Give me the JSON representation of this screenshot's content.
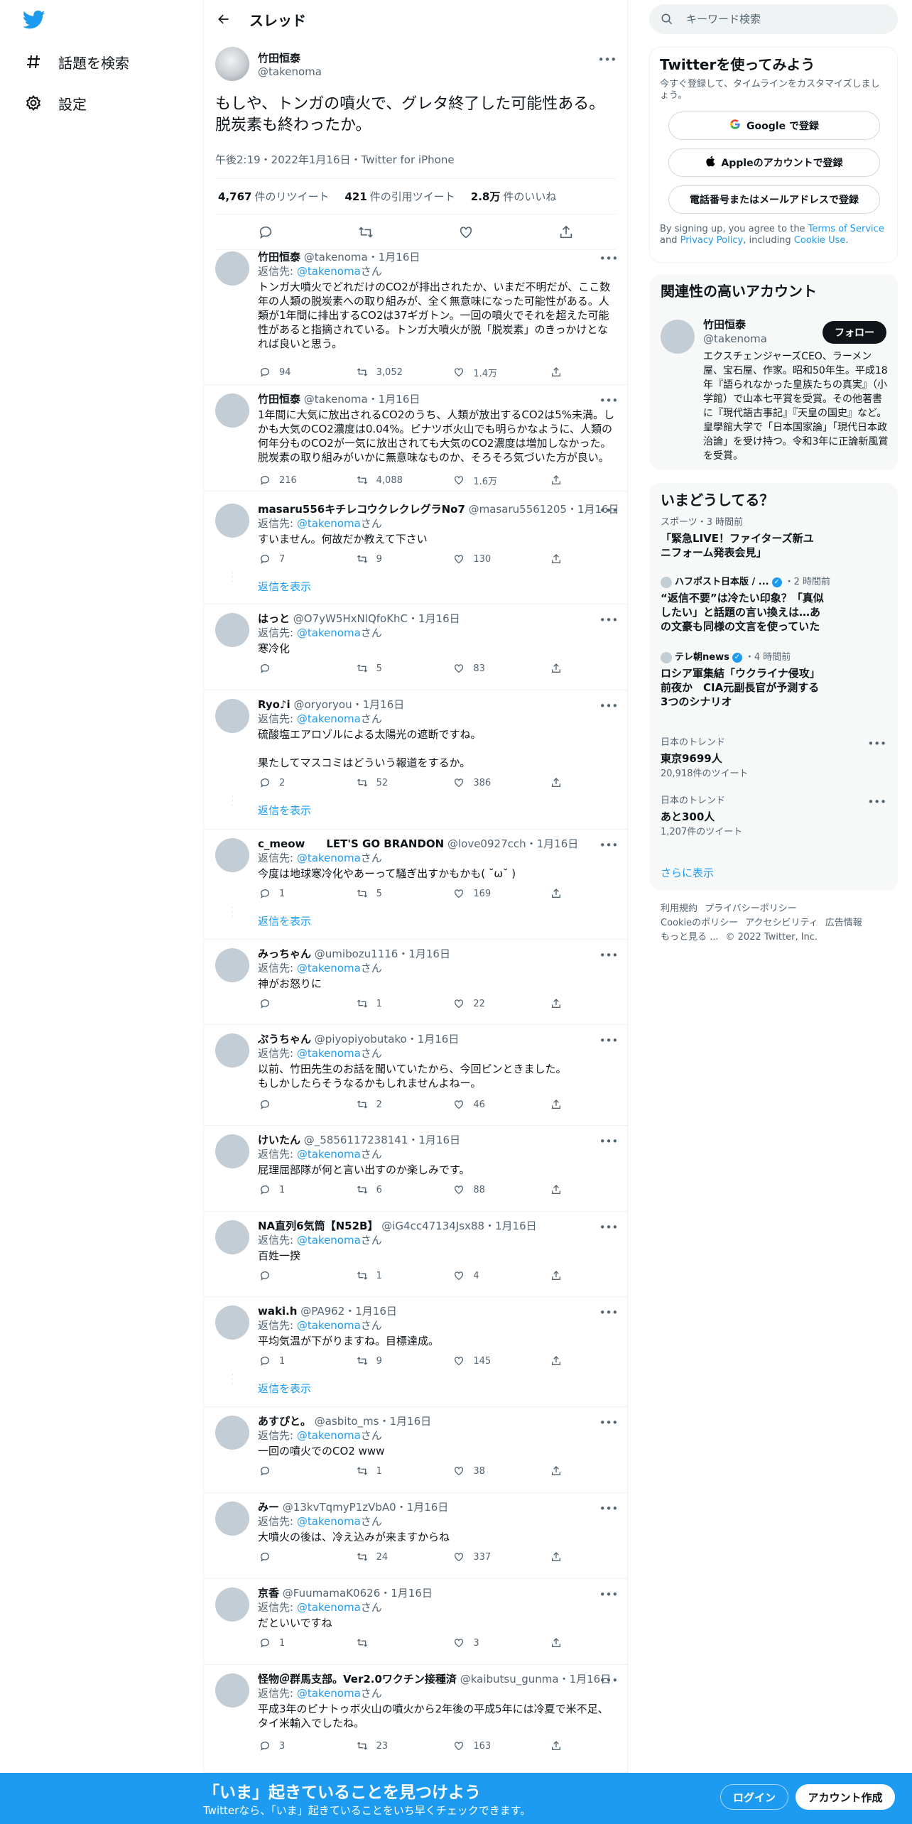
{
  "nav": {
    "explore": "話題を検索",
    "settings": "設定"
  },
  "header": {
    "title": "スレッド"
  },
  "focal": {
    "name": "竹田恒泰",
    "handle": "@takenoma",
    "text": "もしや、トンガの噴火で、グレタ終了した可能性ある。脱炭素も終わったか。",
    "meta": "午後2:19・2022年1月16日・Twitter for iPhone",
    "retweets_num": "4,767",
    "retweets_label": "件のリツイート",
    "quotes_num": "421",
    "quotes_label": "件の引用ツイート",
    "likes_num": "2.8万",
    "likes_label": "件のいいね"
  },
  "replies": [
    {
      "name": "竹田恒泰",
      "handle": "@takenoma",
      "date": "・1月16日",
      "replyto_prefix": "返信先: ",
      "replyto": "@takenoma",
      "replyto_suffix": "さん",
      "text": "トンガ大噴火でどれだけのCO2が排出されたか、いまだ不明だが、ここ数年の人類の脱炭素への取り組みが、全く無意味になった可能性がある。人類が1年間に排出するCO2は37ギガトン。一回の噴火でそれを超えた可能性があると指摘されている。トンガ大噴火が脱「脱炭素」のきっかけとなれば良いと思う。",
      "reply": "94",
      "retweet": "3,052",
      "like": "1.4万",
      "show": ""
    },
    {
      "name": "竹田恒泰",
      "handle": "@takenoma",
      "date": "・1月16日",
      "replyto_prefix": "",
      "replyto": "",
      "replyto_suffix": "",
      "text": "1年間に大気に放出されるCO2のうち、人類が放出するCO2は5%未満。しかも大気のCO2濃度は0.04%。ピナツボ火山でも明らかなように、人類の何年分ものCO2が一気に放出されても大気のCO2濃度は増加しなかった。脱炭素の取り組みがいかに無意味なものか、そろそろ気づいた方が良い。",
      "reply": "216",
      "retweet": "4,088",
      "like": "1.6万",
      "show": ""
    },
    {
      "name": "masaru556キチレコウクレクレグラNo7",
      "handle": "@masaru5561205",
      "date": "・1月16日",
      "replyto_prefix": "返信先: ",
      "replyto": "@takenoma",
      "replyto_suffix": "さん",
      "text": "すいません。何故だか教えて下さい",
      "reply": "7",
      "retweet": "9",
      "like": "130",
      "show": "返信を表示"
    },
    {
      "name": "はっと",
      "handle": "@O7yW5HxNlQfoKhC",
      "date": "・1月16日",
      "replyto_prefix": "返信先: ",
      "replyto": "@takenoma",
      "replyto_suffix": "さん",
      "text": "寒冷化",
      "reply": "",
      "retweet": "5",
      "like": "83",
      "show": ""
    },
    {
      "name": "Ryo♪i",
      "handle": "@oryoryou",
      "date": "・1月16日",
      "replyto_prefix": "返信先: ",
      "replyto": "@takenoma",
      "replyto_suffix": "さん",
      "text": "硫酸塩エアロゾルによる太陽光の遮断ですね。\n\n果たしてマスコミはどういう報道をするか。",
      "reply": "2",
      "retweet": "52",
      "like": "386",
      "show": "返信を表示"
    },
    {
      "name": "c_meow　　LET'S GO BRANDON",
      "handle": "@love0927cch",
      "date": "・1月16日",
      "replyto_prefix": "返信先: ",
      "replyto": "@takenoma",
      "replyto_suffix": "さん",
      "text": "今度は地球寒冷化やあーって騒ぎ出すかもかも( ˘ω˘ )",
      "reply": "1",
      "retweet": "5",
      "like": "169",
      "show": "返信を表示"
    },
    {
      "name": "みっちゃん",
      "handle": "@umibozu1116",
      "date": "・1月16日",
      "replyto_prefix": "返信先: ",
      "replyto": "@takenoma",
      "replyto_suffix": "さん",
      "text": "神がお怒りに",
      "reply": "",
      "retweet": "1",
      "like": "22",
      "show": ""
    },
    {
      "name": "ぷうちゃん",
      "handle": "@piyopiyobutako",
      "date": "・1月16日",
      "replyto_prefix": "返信先: ",
      "replyto": "@takenoma",
      "replyto_suffix": "さん",
      "text": "以前、竹田先生のお話を聞いていたから、今回ピンときました。\nもしかしたらそうなるかもしれませんよねー。",
      "reply": "",
      "retweet": "2",
      "like": "46",
      "show": ""
    },
    {
      "name": "けいたん",
      "handle": "@_5856117238141",
      "date": "・1月16日",
      "replyto_prefix": "返信先: ",
      "replyto": "@takenoma",
      "replyto_suffix": "さん",
      "text": "屁理屈部隊が何と言い出すのか楽しみです。",
      "reply": "1",
      "retweet": "6",
      "like": "88",
      "show": ""
    },
    {
      "name": "NA直列6気筒【N52B】",
      "handle": "@iG4cc47134Jsx88",
      "date": "・1月16日",
      "replyto_prefix": "返信先: ",
      "replyto": "@takenoma",
      "replyto_suffix": "さん",
      "text": "百姓一揆",
      "reply": "",
      "retweet": "1",
      "like": "4",
      "show": ""
    },
    {
      "name": "waki.h",
      "handle": "@PA962",
      "date": "・1月16日",
      "replyto_prefix": "返信先: ",
      "replyto": "@takenoma",
      "replyto_suffix": "さん",
      "text": "平均気温が下がりますね。目標達成。",
      "reply": "1",
      "retweet": "9",
      "like": "145",
      "show": "返信を表示"
    },
    {
      "name": "あすぴと。",
      "handle": "@asbito_ms",
      "date": "・1月16日",
      "replyto_prefix": "返信先: ",
      "replyto": "@takenoma",
      "replyto_suffix": "さん",
      "text": "一回の噴火でのCO2 www",
      "reply": "",
      "retweet": "1",
      "like": "38",
      "show": ""
    },
    {
      "name": "みー",
      "handle": "@13kvTqmyP1zVbA0",
      "date": "・1月16日",
      "replyto_prefix": "返信先: ",
      "replyto": "@takenoma",
      "replyto_suffix": "さん",
      "text": "大噴火の後は、冷え込みが来ますからね",
      "reply": "",
      "retweet": "24",
      "like": "337",
      "show": ""
    },
    {
      "name": "京香",
      "handle": "@FuumamaK0626",
      "date": "・1月16日",
      "replyto_prefix": "返信先: ",
      "replyto": "@takenoma",
      "replyto_suffix": "さん",
      "text": "だといいですね",
      "reply": "1",
      "retweet": "",
      "like": "3",
      "show": ""
    },
    {
      "name": "怪物＠群馬支部。Ver2.0ワクチン接種済",
      "handle": "@kaibutsu_gunma",
      "date": "・1月16日",
      "replyto_prefix": "返信先: ",
      "replyto": "@takenoma",
      "replyto_suffix": "さん",
      "text": "平成3年のピナトゥボ火山の噴火から2年後の平成5年には冷夏で米不足、タイ米輸入でしたね。",
      "reply": "3",
      "retweet": "23",
      "like": "163",
      "show": ""
    }
  ],
  "search": {
    "placeholder": "キーワード検索"
  },
  "signup": {
    "title": "Twitterを使ってみよう",
    "sub": "今すぐ登録して、タイムラインをカスタマイズしましょう。",
    "google": "Google で登録",
    "apple": "Appleのアカウントで登録",
    "phone": "電話番号またはメールアドレスで登録",
    "legal_1": "By signing up, you agree to the ",
    "terms": "Terms of Service",
    "legal_2": " and ",
    "privacy": "Privacy Policy",
    "legal_3": ", including ",
    "cookie": "Cookie Use",
    "legal_4": "."
  },
  "related": {
    "title": "関連性の高いアカウント",
    "name": "竹田恒泰",
    "handle": "@takenoma",
    "follow": "フォロー",
    "bio": "エクスチェンジャーズCEO、ラーメン屋、宝石屋、作家。昭和50年生。平成18年『語られなかった皇族たちの真実』（小学館）で山本七平賞を受賞。その他著書に『現代語古事記』『天皇の国史』など。皇學館大学で「日本国家論」「現代日本政治論」を受け持つ。令和3年に正論新風賞を受賞。"
  },
  "trends": {
    "title": "いまどうしてる？",
    "items": [
      {
        "category": "スポーツ・3 時間前",
        "source": "",
        "title": "「緊急LIVE！ファイターズ新ユニフォーム発表会見」",
        "count": ""
      },
      {
        "category": "・2 時間前",
        "source": "ハフポスト日本版 / ...",
        "title": "“返信不要”は冷たい印象？「真似したい」と話題の言い換えは…あの文豪も同様の文言を使っていた",
        "count": ""
      },
      {
        "category": "・4 時間前",
        "source": "テレ朝news",
        "title": "ロシア軍集結「ウクライナ侵攻」前夜か　CIA元副長官が予測する3つのシナリオ",
        "count": ""
      },
      {
        "category": "日本のトレンド",
        "source": "",
        "title": "東京9699人",
        "count": "20,918件のツイート"
      },
      {
        "category": "日本のトレンド",
        "source": "",
        "title": "あと300人",
        "count": "1,207件のツイート"
      }
    ],
    "show_more": "さらに表示"
  },
  "footer": {
    "terms": "利用規約",
    "privacy": "プライバシーポリシー",
    "cookie": "Cookieのポリシー",
    "accessibility": "アクセシビリティ",
    "ads": "広告情報",
    "more": "もっと見る ...",
    "copyright": "© 2022 Twitter, Inc."
  },
  "bottom": {
    "title": "「いま」起きていることを見つけよう",
    "sub": "Twitterなら、「いま」起きていることをいち早くチェックできます。",
    "login": "ログイン",
    "signup": "アカウント作成"
  },
  "colors": {
    "accent": "#1d9bf0",
    "text": "#0f1419",
    "muted": "#536471"
  }
}
